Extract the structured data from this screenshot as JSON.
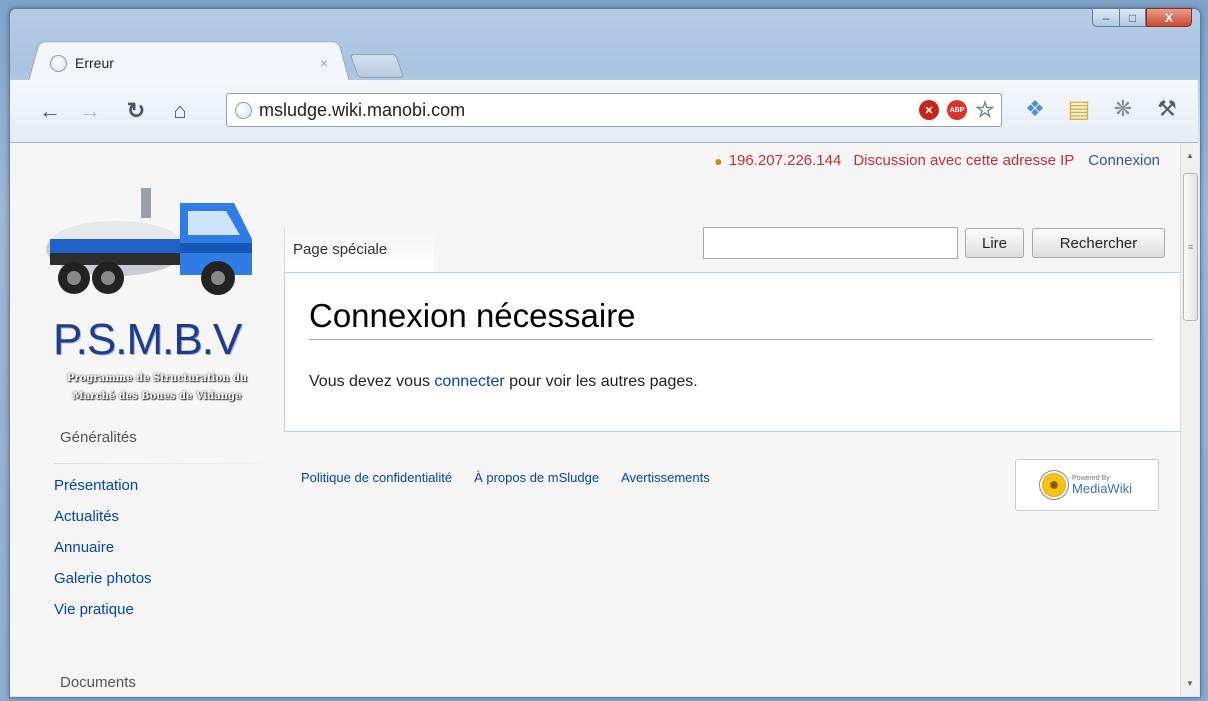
{
  "browser": {
    "tab_title": "Erreur",
    "tab_close": "×",
    "url": "msludge.wiki.manobi.com",
    "window_controls": {
      "minimize": "–",
      "maximize": "□",
      "close": "X"
    }
  },
  "personal": {
    "ip": "196.207.226.144",
    "talk": "Discussion avec cette adresse IP",
    "login": "Connexion"
  },
  "logo": {
    "title": "P.S.M.B.V",
    "subtitle_line1": "Programme de Structuration du",
    "subtitle_line2": "Marché des Boues de Vidange"
  },
  "sidebar": {
    "sections": [
      {
        "heading": "Généralités",
        "items": [
          "Présentation",
          "Actualités",
          "Annuaire",
          "Galerie photos",
          "Vie pratique"
        ]
      },
      {
        "heading": "Documents",
        "items": []
      }
    ]
  },
  "content": {
    "namespace_tab": "Page spéciale",
    "search_placeholder": "",
    "read_button": "Lire",
    "search_button": "Rechercher",
    "heading": "Connexion nécessaire",
    "body_before": "Vous devez vous ",
    "body_link": "connecter",
    "body_after": " pour voir les autres pages."
  },
  "footer": {
    "links": [
      "Politique de confidentialité",
      "À propos de mSludge",
      "Avertissements"
    ],
    "powered_small": "Powered By",
    "powered_big": "MediaWiki"
  },
  "colors": {
    "link": "#0645ad",
    "user_red": "#cc2e2e",
    "content_border": "#a7d7f9"
  }
}
